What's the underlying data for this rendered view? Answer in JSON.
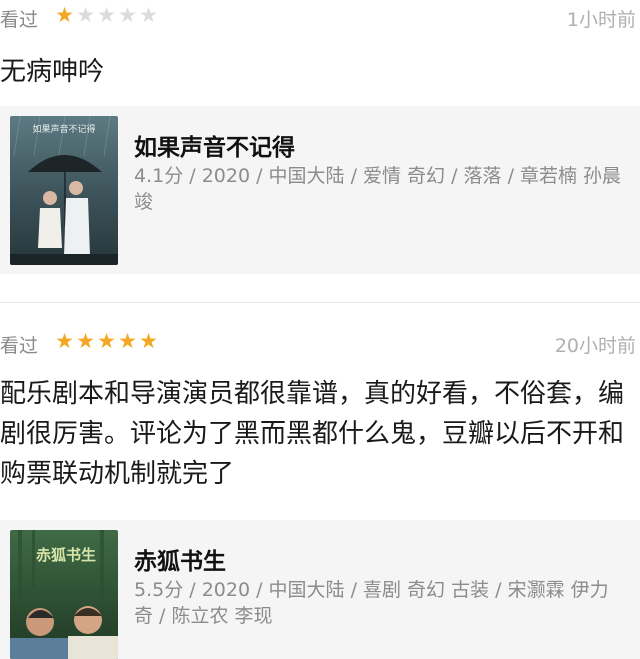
{
  "reviews": [
    {
      "action": "看过",
      "rating": 1,
      "max_rating": 5,
      "time": "1小时前",
      "comment": "无病呻吟",
      "movie": {
        "title": "如果声音不记得",
        "info": "4.1分 / 2020 / 中国大陆 / 爱情 奇幻 / 落落 / 章若楠 孙晨竣",
        "poster_text": "如果声音不记得"
      }
    },
    {
      "action": "看过",
      "rating": 5,
      "max_rating": 5,
      "time": "20小时前",
      "comment": "配乐剧本和导演演员都很靠谱，真的好看，不俗套，编剧很厉害。评论为了黑而黑都什么鬼，豆瓣以后不开和购票联动机制就完了",
      "movie": {
        "title": "赤狐书生",
        "info": "5.5分 / 2020 / 中国大陆 / 喜剧 奇幻 古装 / 宋灏霖 伊力奇 / 陈立农 李现",
        "poster_text": "赤狐书生"
      }
    }
  ],
  "colors": {
    "star_on": "#f5a623",
    "star_off": "#dcdcdc",
    "card_bg": "#f5f5f5"
  }
}
